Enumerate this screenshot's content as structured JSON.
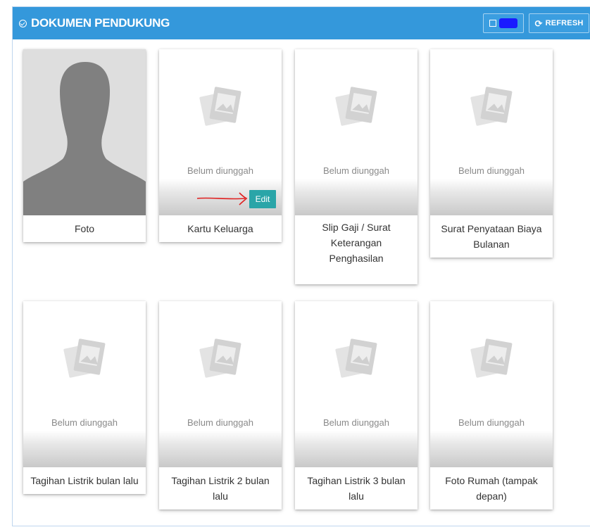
{
  "panel": {
    "title": "DOKUMEN PENDUKUNG",
    "refresh_label": "REFRESH",
    "accent_color": "#3498db"
  },
  "documents": [
    {
      "caption": "Foto",
      "status": ""
    },
    {
      "caption": "Kartu Keluarga",
      "status": "Belum diunggah",
      "edit_label": "Edit"
    },
    {
      "caption": "Slip Gaji / Surat Keterangan Penghasilan",
      "status": "Belum diunggah"
    },
    {
      "caption": "Surat Penyataan Biaya Bulanan",
      "status": "Belum diunggah"
    },
    {
      "caption": "Tagihan Listrik bulan lalu",
      "status": "Belum diunggah"
    },
    {
      "caption": "Tagihan Listrik 2 bulan lalu",
      "status": "Belum diunggah"
    },
    {
      "caption": "Tagihan Listrik 3 bulan lalu",
      "status": "Belum diunggah"
    },
    {
      "caption": "Foto Rumah (tampak depan)",
      "status": "Belum diunggah"
    }
  ]
}
